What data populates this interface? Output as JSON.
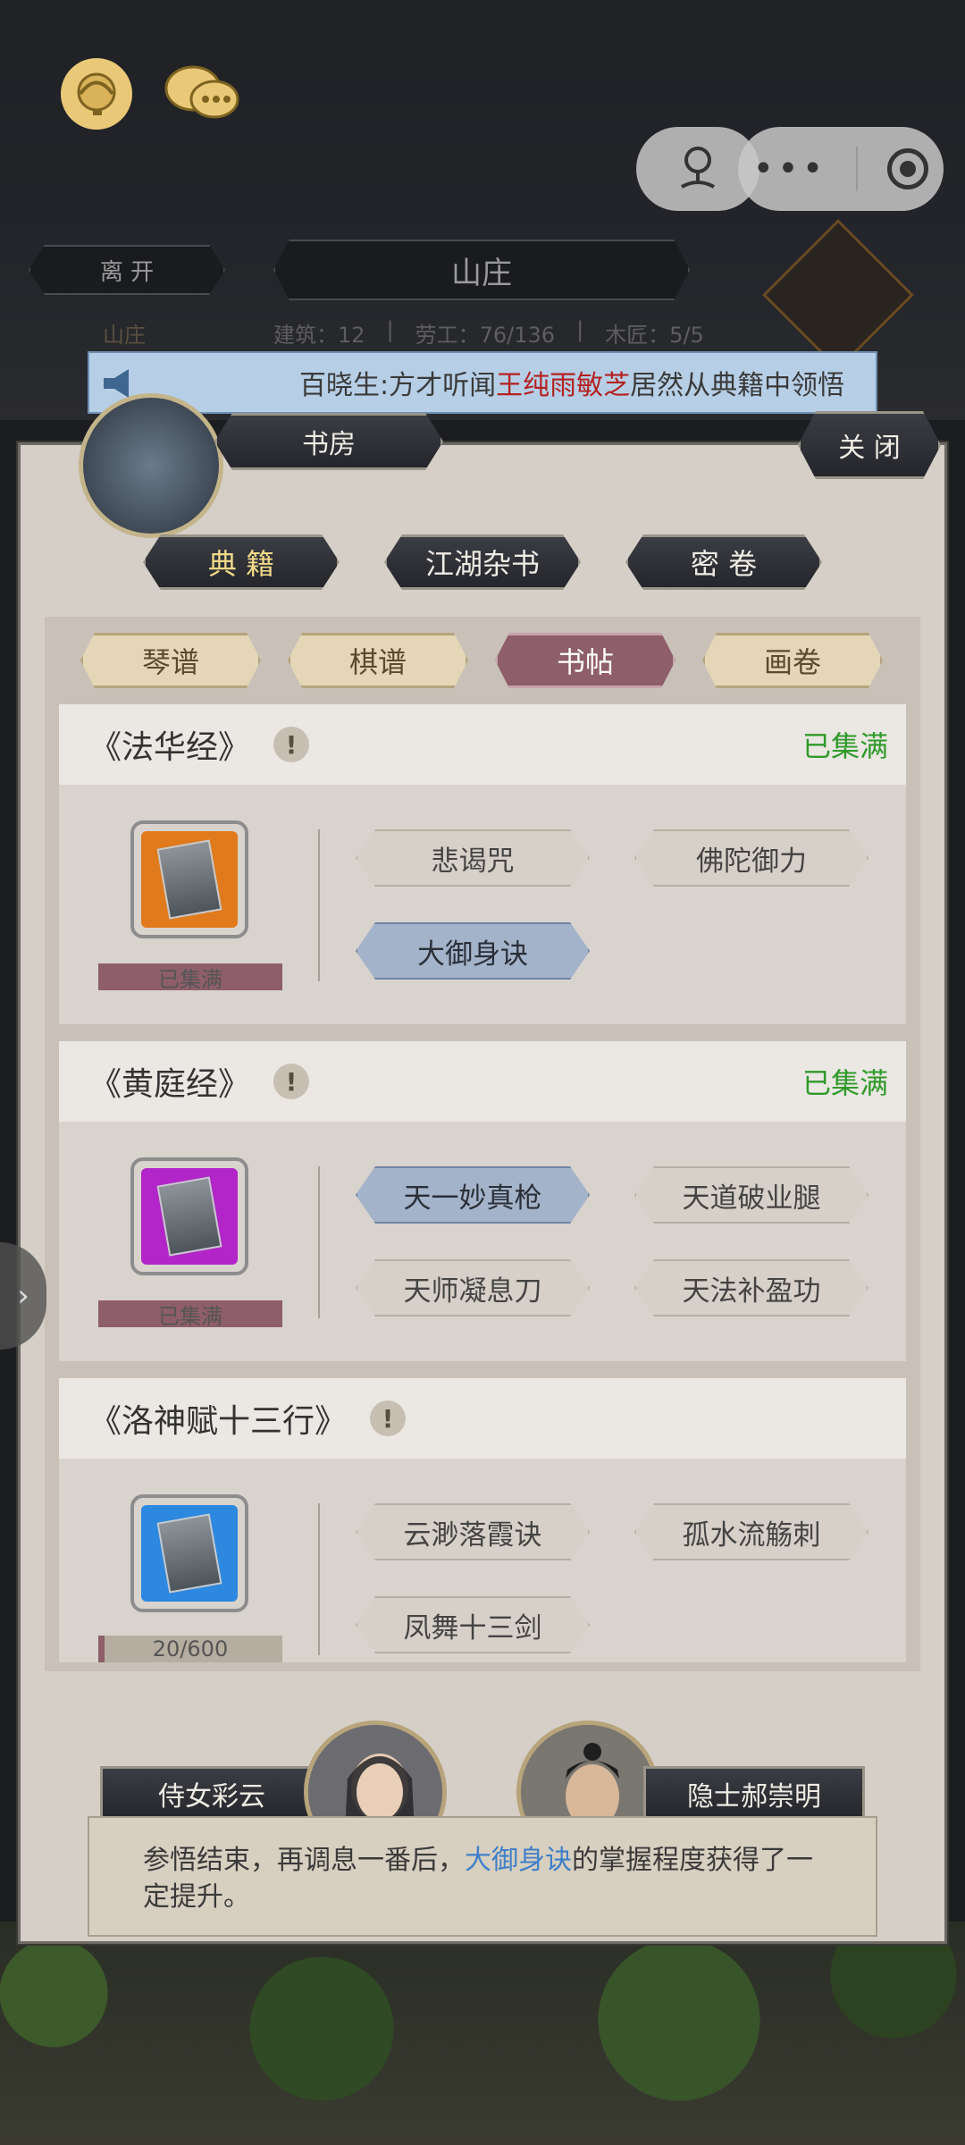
{
  "hud": {
    "leave_label": "离 开",
    "location_title": "山庄",
    "location_sub": "山庄",
    "stats": [
      {
        "label": "建筑",
        "value": "12"
      },
      {
        "label": "劳工",
        "value": "76/136"
      },
      {
        "label": "木匠",
        "value": "5/5"
      }
    ]
  },
  "announcement": {
    "prefix": "百晓生:方才听闻",
    "highlight": "王纯雨敏芝",
    "suffix": "居然从典籍中领悟"
  },
  "panel": {
    "title": "书房",
    "close_label": "关 闭",
    "categories": [
      "典 籍",
      "江湖杂书",
      "密 卷"
    ],
    "active_category": 0,
    "sub_tabs": [
      "琴谱",
      "棋谱",
      "书帖",
      "画卷"
    ],
    "active_sub_tab": 2
  },
  "books": [
    {
      "title": "《法华经》",
      "status": "已集满",
      "progress_label": "已集满",
      "progress": 1.0,
      "icon_color": "#e07a1c",
      "skills": [
        {
          "name": "悲谒咒",
          "learned": false
        },
        {
          "name": "佛陀御力",
          "learned": false
        },
        {
          "name": "大御身诀",
          "learned": true
        }
      ]
    },
    {
      "title": "《黄庭经》",
      "status": "已集满",
      "progress_label": "已集满",
      "progress": 1.0,
      "icon_color": "#b225c8",
      "skills": [
        {
          "name": "天一妙真枪",
          "learned": true
        },
        {
          "name": "天道破业腿",
          "learned": false
        },
        {
          "name": "天师凝息刀",
          "learned": false
        },
        {
          "name": "天法补盈功",
          "learned": false
        }
      ]
    },
    {
      "title": "《洛神赋十三行》",
      "status": "",
      "progress_label": "20/600",
      "progress": 0.033,
      "icon_color": "#2d88e0",
      "skills": [
        {
          "name": "云渺落霞诀",
          "learned": false
        },
        {
          "name": "孤水流觞刺",
          "learned": false
        },
        {
          "name": "凤舞十三剑",
          "learned": false
        }
      ]
    }
  ],
  "npcs": [
    {
      "name": "侍女彩云"
    },
    {
      "name": "隐士郝崇明"
    }
  ],
  "message": {
    "prefix": "参悟结束，再调息一番后，",
    "highlight": "大御身诀",
    "suffix": "的掌握程度获得了一定提升。"
  }
}
